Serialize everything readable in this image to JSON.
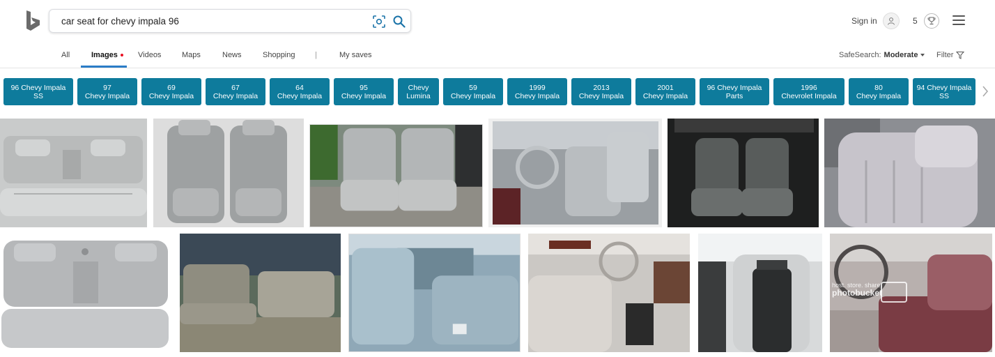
{
  "search": {
    "query": "car seat for chevy impala 96"
  },
  "header": {
    "signin_label": "Sign in",
    "rewards_count": "5"
  },
  "nav": {
    "tabs": [
      {
        "label": "All"
      },
      {
        "label": "Images"
      },
      {
        "label": "Videos"
      },
      {
        "label": "Maps"
      },
      {
        "label": "News"
      },
      {
        "label": "Shopping"
      },
      {
        "label": "My saves"
      }
    ],
    "separator": "|",
    "safesearch_label": "SafeSearch:",
    "safesearch_value": "Moderate",
    "filter_label": "Filter"
  },
  "chips": [
    {
      "l1": "96 Chevy Impala",
      "l2": "SS"
    },
    {
      "l1": "97",
      "l2": "Chevy Impala"
    },
    {
      "l1": "69",
      "l2": "Chevy Impala"
    },
    {
      "l1": "67",
      "l2": "Chevy Impala"
    },
    {
      "l1": "64",
      "l2": "Chevy Impala"
    },
    {
      "l1": "95",
      "l2": "Chevy Impala"
    },
    {
      "l1": "Chevy",
      "l2": "Lumina"
    },
    {
      "l1": "59",
      "l2": "Chevy Impala"
    },
    {
      "l1": "1999",
      "l2": "Chevy Impala"
    },
    {
      "l1": "2013",
      "l2": "Chevy Impala"
    },
    {
      "l1": "2001",
      "l2": "Chevy Impala"
    },
    {
      "l1": "96 Chevy Impala",
      "l2": "Parts"
    },
    {
      "l1": "1996",
      "l2": "Chevrolet Impala"
    },
    {
      "l1": "80",
      "l2": "Chevy Impala"
    },
    {
      "l1": "94 Chevy Impala",
      "l2": "SS"
    }
  ],
  "watermark": {
    "tagline": "host. store. share.",
    "brand": "photobucket"
  },
  "colors": {
    "accent": "#0e7b9c",
    "active_tab": "#2a7cc7",
    "dot": "#e81123"
  }
}
